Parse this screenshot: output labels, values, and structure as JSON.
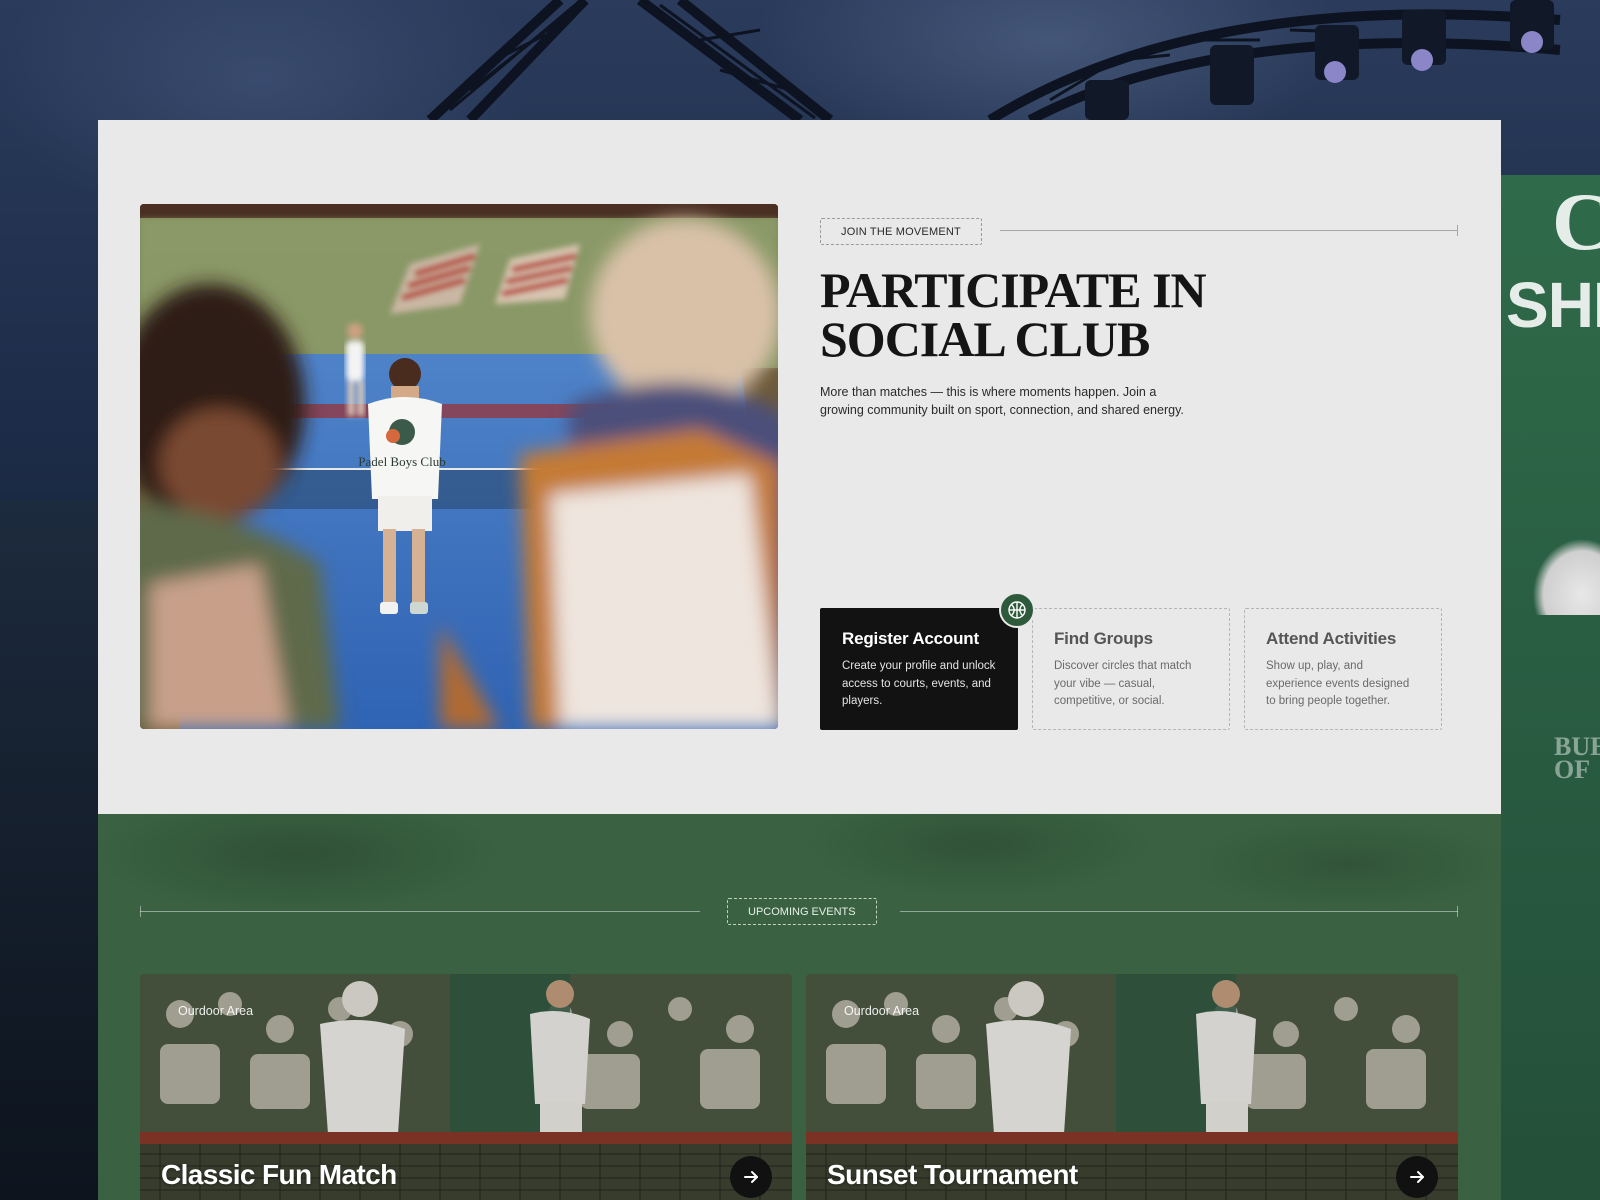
{
  "theme": {
    "accent_green": "#2e5a3c",
    "section_green": "#3a6242",
    "panel_bg": "#e9e9e9",
    "card_active_bg": "#121212"
  },
  "background": {
    "banner_text_top": "C",
    "banner_text_mid": "SHI",
    "banner_text_bottom": "BUE OF"
  },
  "join": {
    "tag": "JOIN THE MOVEMENT",
    "title": "PARTICIPATE IN SOCIAL CLUB",
    "description": "More than matches — this is where moments happen. Join a growing community built on sport, connection, and shared energy.",
    "photo_shirt_text": "Padel Boys Club",
    "badge_icon": "basketball-icon",
    "steps": [
      {
        "title": "Register Account",
        "description": "Create your profile and unlock access to courts, events, and players.",
        "active": true
      },
      {
        "title": "Find Groups",
        "description": "Discover circles that match your vibe — casual, competitive, or social.",
        "active": false
      },
      {
        "title": "Attend Activities",
        "description": "Show up, play, and experience events designed to bring people together.",
        "active": false
      }
    ]
  },
  "events": {
    "tag": "UPCOMING EVENTS",
    "items": [
      {
        "location": "Ourdoor Area",
        "title": "Classic Fun Match",
        "arrow_icon": "arrow-right-icon"
      },
      {
        "location": "Ourdoor Area",
        "title": "Sunset Tournament",
        "arrow_icon": "arrow-right-icon"
      }
    ]
  }
}
